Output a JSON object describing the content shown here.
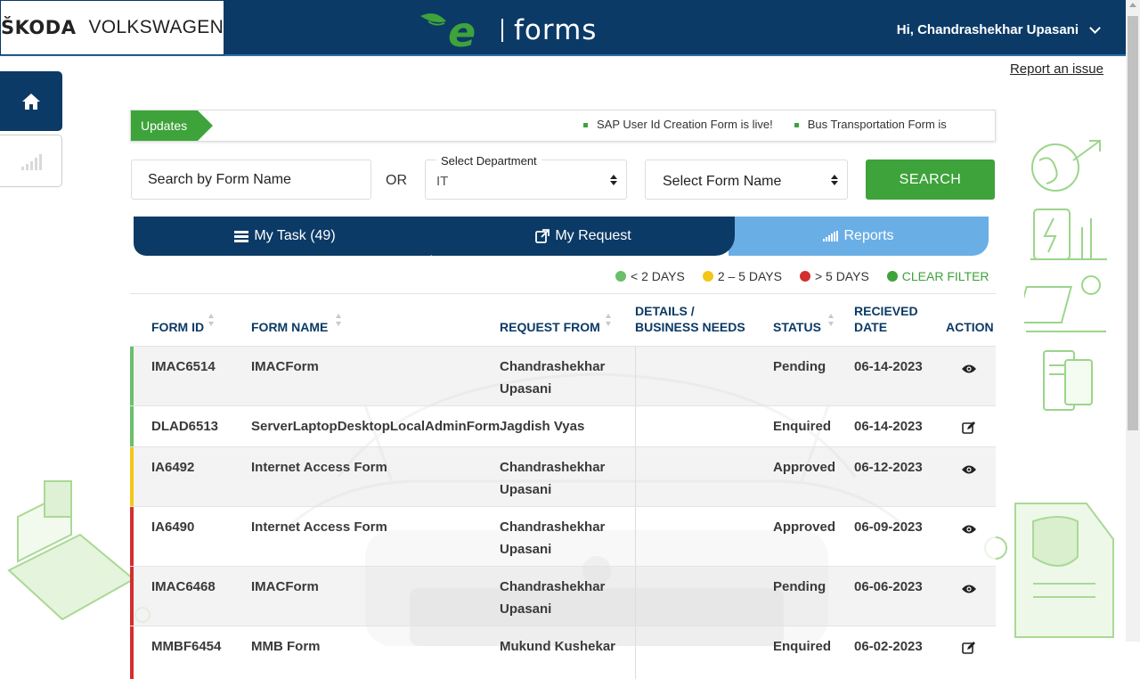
{
  "header": {
    "brand_left": "ŠKODA",
    "brand_right": "VOLKSWAGEN",
    "logo_text": "forms",
    "greeting": "Hi, Chandrashekhar Upasani"
  },
  "links": {
    "report_issue": "Report an issue"
  },
  "updates": {
    "label": "Updates",
    "items": [
      "SAP User Id Creation Form is live!",
      "Bus Transportation Form is"
    ]
  },
  "search": {
    "placeholder": "Search by Form Name",
    "or_label": "OR",
    "department_label": "Select Department",
    "department_value": "IT",
    "form_select_value": "Select Form Name",
    "button": "SEARCH"
  },
  "tabs": {
    "my_task": "My Task (49)",
    "my_request": "My Request",
    "reports": "Reports"
  },
  "legend": {
    "lt2": "< 2 DAYS",
    "mid": "2 – 5 DAYS",
    "gt5": "> 5 DAYS",
    "clear": "CLEAR FILTER",
    "colors": {
      "green": "#6abf69",
      "yellow": "#f5c518",
      "red": "#d32f2f",
      "clear": "#3ea33a"
    }
  },
  "table": {
    "headers": {
      "form_id": "FORM ID",
      "form_name": "FORM NAME",
      "request_from": "REQUEST FROM",
      "details": "DETAILS / BUSINESS NEEDS",
      "status": "STATUS",
      "received": "RECIEVED DATE",
      "action": "ACTION"
    },
    "rows": [
      {
        "id": "IMAC6514",
        "name": "IMACForm",
        "from": "Chandrashekhar Upasani",
        "status": "Pending",
        "date": "06-14-2023",
        "action": "view-icon",
        "flag": "green"
      },
      {
        "id": "DLAD6513",
        "name": "ServerLaptopDesktopLocalAdminForm",
        "from": "Jagdish Vyas",
        "status": "Enquired",
        "date": "06-14-2023",
        "action": "edit-icon",
        "flag": "green"
      },
      {
        "id": "IA6492",
        "name": "Internet Access Form",
        "from": "Chandrashekhar Upasani",
        "status": "Approved",
        "date": "06-12-2023",
        "action": "view-icon",
        "flag": "yellow"
      },
      {
        "id": "IA6490",
        "name": "Internet Access Form",
        "from": "Chandrashekhar Upasani",
        "status": "Approved",
        "date": "06-09-2023",
        "action": "view-icon",
        "flag": "red"
      },
      {
        "id": "IMAC6468",
        "name": "IMACForm",
        "from": "Chandrashekhar Upasani",
        "status": "Pending",
        "date": "06-06-2023",
        "action": "view-icon",
        "flag": "red"
      },
      {
        "id": "MMBF6454",
        "name": "MMB Form",
        "from": "Mukund Kushekar",
        "status": "Enquired",
        "date": "06-02-2023",
        "action": "edit-icon",
        "flag": "red"
      }
    ]
  }
}
